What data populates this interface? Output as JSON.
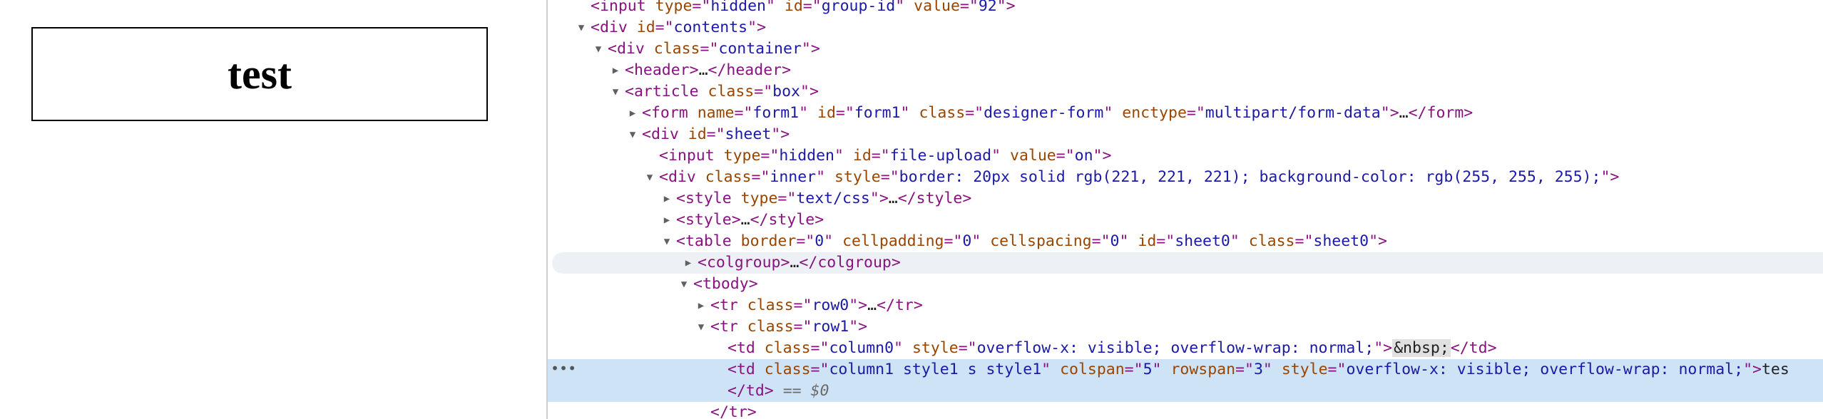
{
  "page": {
    "box_text": "test"
  },
  "devtools": {
    "lines": [
      {
        "t": "<input type=\"hidden\" id=\"group-id\" value=\"92\">"
      },
      {
        "t": "<div id=\"contents\">"
      },
      {
        "t": "<div class=\"container\">"
      },
      {
        "t": "<header>…</header>"
      },
      {
        "t": "<article class=\"box\">"
      },
      {
        "t": "<form name=\"form1\" id=\"form1\" class=\"designer-form\" enctype=\"multipart/form-data\">…</form>"
      },
      {
        "t": "<div id=\"sheet\">"
      },
      {
        "t": "<input type=\"hidden\" id=\"file-upload\" value=\"on\">"
      },
      {
        "t": "<div class=\"inner\" style=\"border: 20px solid rgb(221, 221, 221); background-color: rgb(255, 255, 255);\">"
      },
      {
        "t": "<style type=\"text/css\">…</style>"
      },
      {
        "t": "<style>…</style>"
      },
      {
        "t": "<table border=\"0\" cellpadding=\"0\" cellspacing=\"0\" id=\"sheet0\" class=\"sheet0\">"
      },
      {
        "t": "<colgroup>…</colgroup>"
      },
      {
        "t": "<tbody>"
      },
      {
        "t": "<tr class=\"row0\">…</tr>"
      },
      {
        "t": "<tr class=\"row1\">"
      },
      {
        "t": "<td class=\"column0\" style=\"overflow-x: visible; overflow-wrap: normal;\">&nbsp;</td>"
      },
      {
        "t": "<td class=\"column1 style1 s style1\" colspan=\"5\" rowspan=\"3\" style=\"overflow-x: visible; overflow-wrap: normal;\">tes"
      },
      {
        "t": "</td> == $0"
      },
      {
        "t": "</tr>"
      }
    ],
    "selected_marker": "== $0",
    "gutter_ellipsis": "•••"
  }
}
